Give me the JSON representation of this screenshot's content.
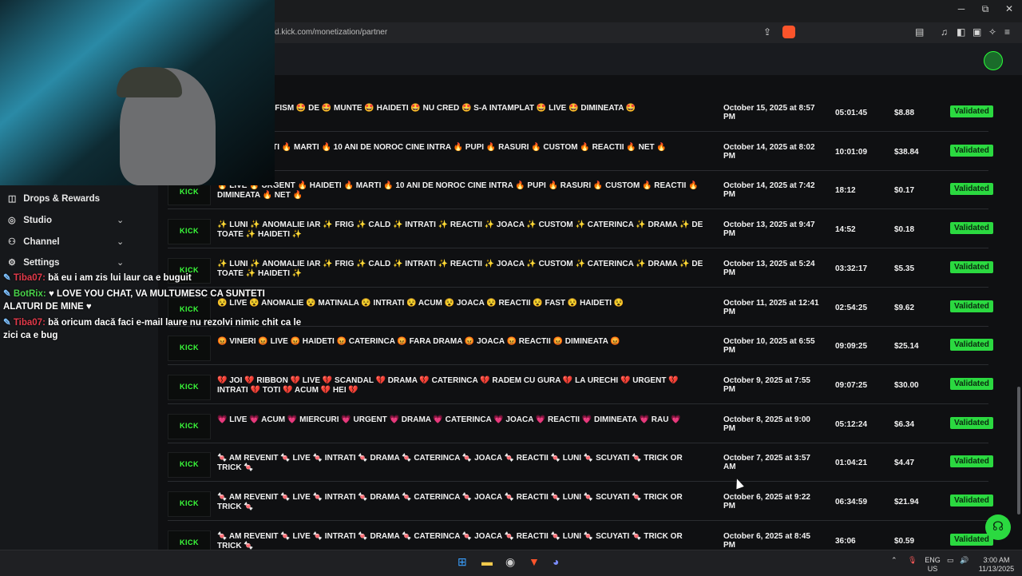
{
  "window": {
    "minimize": "─",
    "restore": "⧉",
    "close": "✕"
  },
  "browser": {
    "url": "d.kick.com/monetization/partner"
  },
  "sidebar": {
    "items": [
      {
        "label": "Drops & Rewards",
        "icon": "gift-icon",
        "has_chevron": false
      },
      {
        "label": "Studio",
        "icon": "studio-icon",
        "has_chevron": true
      },
      {
        "label": "Channel",
        "icon": "channel-icon",
        "has_chevron": true
      },
      {
        "label": "Settings",
        "icon": "gear-icon",
        "has_chevron": true
      }
    ]
  },
  "chat": {
    "messages": [
      {
        "user": "Tiba07:",
        "text": "bă eu i am zis lui laur ca e buguit"
      },
      {
        "user": "BotRix:",
        "text": "♥ LOVE YOU CHAT, VA MULTUMESC CA SUNTETI ALATURI DE MINE ♥"
      },
      {
        "user": "Tiba07:",
        "text": "bă oricum dacă faci e-mail laure nu rezolvi nimic chit ca le zici ca e bug"
      }
    ]
  },
  "streams": {
    "status_label": "Validated",
    "thumb_label": "KICK",
    "rows": [
      {
        "title": "ACUTA 🤩 VARFISM 🤩 DE 🤩 MUNTE 🤩 HAIDETI 🤩 NU CRED 🤩 S-A INTAMPLAT 🤩 LIVE 🤩 DIMINEATA 🤩",
        "date": "October 15, 2025 at 8:57 PM",
        "duration": "05:01:45",
        "earnings": "$8.88"
      },
      {
        "title": "ENT 🔥 HAIDETI 🔥 MARTI 🔥 10 ANI DE NOROC CINE INTRA 🔥 PUPI 🔥 RASURI 🔥 CUSTOM 🔥 REACTII 🔥 NET 🔥",
        "date": "October 14, 2025 at 8:02 PM",
        "duration": "10:01:09",
        "earnings": "$38.84"
      },
      {
        "title": "🔥 LIVE 🔥 URGENT 🔥 HAIDETI 🔥 MARTI 🔥 10 ANI DE NOROC CINE INTRA 🔥 PUPI 🔥 RASURI 🔥 CUSTOM 🔥 REACTII 🔥 DIMINEATA 🔥 NET 🔥",
        "date": "October 14, 2025 at 7:42 PM",
        "duration": "18:12",
        "earnings": "$0.17"
      },
      {
        "title": "✨ LUNI ✨ ANOMALIE IAR ✨ FRIG ✨ CALD ✨ INTRATI ✨ REACTII ✨ JOACA ✨ CUSTOM ✨ CATERINCA ✨ DRAMA ✨ DE TOATE ✨ HAIDETI ✨",
        "date": "October 13, 2025 at 9:47 PM",
        "duration": "14:52",
        "earnings": "$0.18"
      },
      {
        "title": "✨ LUNI ✨ ANOMALIE IAR ✨ FRIG ✨ CALD ✨ INTRATI ✨ REACTII ✨ JOACA ✨ CUSTOM ✨ CATERINCA ✨ DRAMA ✨ DE TOATE ✨ HAIDETI ✨",
        "date": "October 13, 2025 at 5:24 PM",
        "duration": "03:32:17",
        "earnings": "$5.35"
      },
      {
        "title": "😵 LIVE 😵 ANOMALIE 😵 MATINALA 😵 INTRATI 😵 ACUM 😵 JOACA 😵 REACTII 😵 FAST 😵 HAIDETI 😵",
        "date": "October 11, 2025 at 12:41 PM",
        "duration": "02:54:25",
        "earnings": "$9.62"
      },
      {
        "title": "😡 VINERI 😡 LIVE 😡 HAIDETI 😡 CATERINCA 😡 FARA DRAMA 😡 JOACA 😡 REACTII 😡 DIMINEATA 😡",
        "date": "October 10, 2025 at 6:55 PM",
        "duration": "09:09:25",
        "earnings": "$25.14"
      },
      {
        "title": "💔 JOI 💔 RIBBON 💔 LIVE 💔 SCANDAL 💔 DRAMA 💔 CATERINCA 💔 RADEM CU GURA 💔 LA URECHI 💔 URGENT 💔 INTRATI 💔 TOTI 💔 ACUM 💔 HEI 💔",
        "date": "October 9, 2025 at 7:55 PM",
        "duration": "09:07:25",
        "earnings": "$30.00"
      },
      {
        "title": "💗 LIVE 💗 ACUM 💗 MIERCURI 💗 URGENT 💗 DRAMA 💗 CATERINCA 💗 JOACA 💗 REACTII 💗 DIMINEATA 💗 RAU 💗",
        "date": "October 8, 2025 at 9:00 PM",
        "duration": "05:12:24",
        "earnings": "$6.34"
      },
      {
        "title": "🍬 AM REVENIT 🍬 LIVE 🍬 INTRATI 🍬 DRAMA 🍬 CATERINCA 🍬 JOACA 🍬 REACTII 🍬 LUNI 🍬 SCUYATI 🍬 TRICK OR TRICK 🍬",
        "date": "October 7, 2025 at 3:57 AM",
        "duration": "01:04:21",
        "earnings": "$4.47"
      },
      {
        "title": "🍬 AM REVENIT 🍬 LIVE 🍬 INTRATI 🍬 DRAMA 🍬 CATERINCA 🍬 JOACA 🍬 REACTII 🍬 LUNI 🍬 SCUYATI 🍬 TRICK OR TRICK 🍬",
        "date": "October 6, 2025 at 9:22 PM",
        "duration": "06:34:59",
        "earnings": "$21.94"
      },
      {
        "title": "🍬 AM REVENIT 🍬 LIVE 🍬 INTRATI 🍬 DRAMA 🍬 CATERINCA 🍬 JOACA 🍬 REACTII 🍬 LUNI 🍬 SCUYATI 🍬 TRICK OR TRICK 🍬",
        "date": "October 6, 2025 at 8:45 PM",
        "duration": "36:06",
        "earnings": "$0.59"
      }
    ]
  },
  "taskbar": {
    "lang": "ENG",
    "region": "US",
    "time": "3:00 AM",
    "date": "11/13/2025"
  },
  "colors": {
    "accent": "#2bd940",
    "background": "#0f1012"
  }
}
